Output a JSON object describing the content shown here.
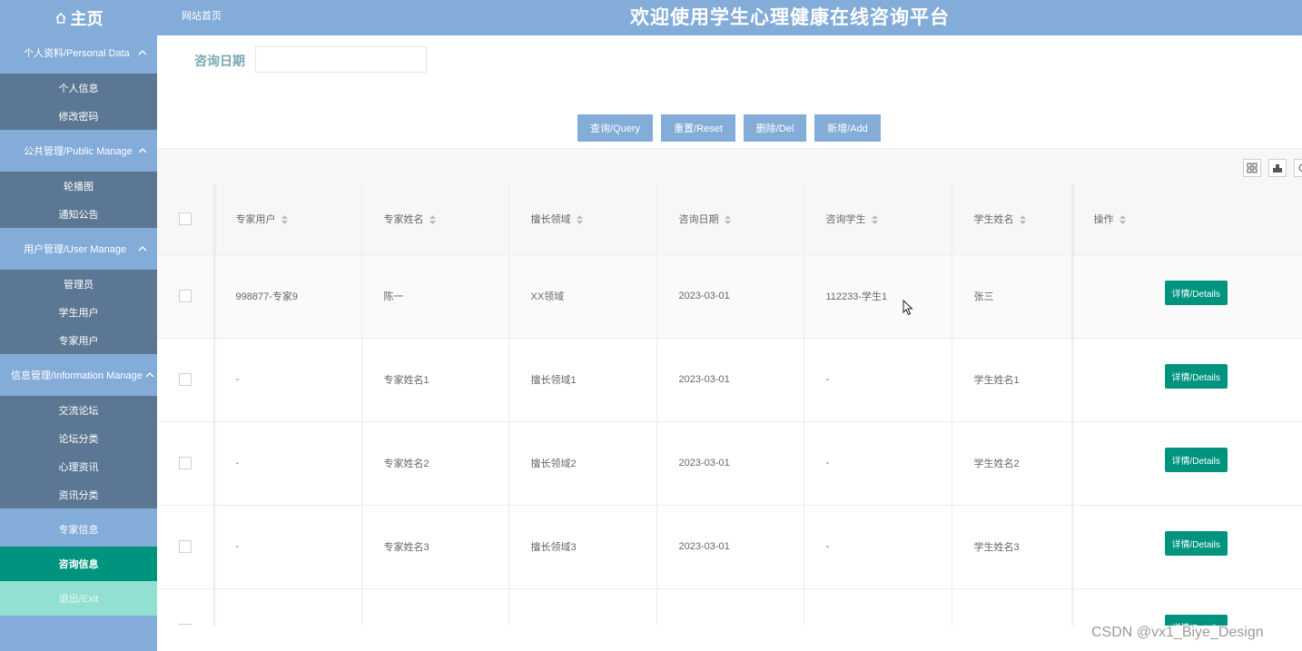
{
  "header": {
    "home_label": "主页",
    "site_link": "网站首页",
    "title": "欢迎使用学生心理健康在线咨询平台"
  },
  "sidebar": {
    "groups": [
      {
        "label": "个人资料/Personal Data",
        "items": [
          "个人信息",
          "修改密码"
        ]
      },
      {
        "label": "公共管理/Public Manage",
        "items": [
          "轮播图",
          "通知公告"
        ]
      },
      {
        "label": "用户管理/User Manage",
        "items": [
          "管理员",
          "学生用户",
          "专家用户"
        ]
      },
      {
        "label": "信息管理/Information Manage",
        "items": [
          "交流论坛",
          "论坛分类",
          "心理资讯",
          "资讯分类"
        ]
      }
    ],
    "expert_info": "专家信息",
    "consult_info": "咨询信息",
    "exit": "退出/Exit"
  },
  "search": {
    "label": "咨询日期",
    "value": ""
  },
  "buttons": {
    "query": "查询/Query",
    "reset": "重置/Reset",
    "delete": "删除/Del",
    "add": "新增/Add"
  },
  "table": {
    "columns": [
      "专家用户",
      "专家姓名",
      "擅长领域",
      "咨询日期",
      "咨询学生",
      "学生姓名",
      "操作"
    ],
    "rows": [
      [
        "998877-专家9",
        "陈一",
        "XX领域",
        "2023-03-01",
        "112233-学生1",
        "张三"
      ],
      [
        "-",
        "专家姓名1",
        "擅长领域1",
        "2023-03-01",
        "-",
        "学生姓名1"
      ],
      [
        "-",
        "专家姓名2",
        "擅长领域2",
        "2023-03-01",
        "-",
        "学生姓名2"
      ],
      [
        "-",
        "专家姓名3",
        "擅长领域3",
        "2023-03-01",
        "-",
        "学生姓名3"
      ]
    ],
    "details_label": "详情/Details"
  },
  "watermark": "CSDN @vx1_Biye_Design",
  "colors": {
    "primary": "#84acd9",
    "submenu": "#5b7793",
    "accent": "#00947f",
    "exit": "#92e0d2"
  }
}
